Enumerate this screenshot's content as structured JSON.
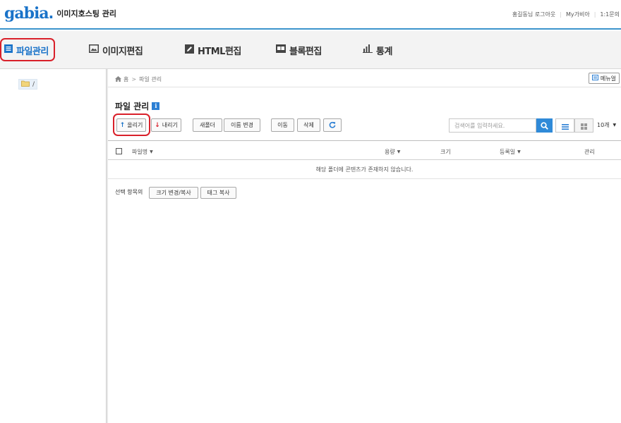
{
  "header": {
    "logo_text": "gabia",
    "service_name": "이미지호스팅 관리",
    "user_greeting": "홍길동님",
    "logout": "로그아웃",
    "my_gabia": "My가비아",
    "inquiry": "1:1문의"
  },
  "nav": {
    "items": [
      {
        "label": "파일관리",
        "icon": "file-list-icon",
        "active": true
      },
      {
        "label": "이미지편집",
        "icon": "image-icon",
        "active": false
      },
      {
        "label": "HTML편집",
        "icon": "pencil-icon",
        "active": false
      },
      {
        "label": "블록편집",
        "icon": "block-icon",
        "active": false
      },
      {
        "label": "통계",
        "icon": "bar-chart-icon",
        "active": false
      }
    ]
  },
  "sidebar": {
    "root_folder": "/"
  },
  "breadcrumb": {
    "home": "홈",
    "current": "파일 관리"
  },
  "menu_button": "메뉴얼",
  "page_title": "파일 관리",
  "toolbar": {
    "upload": "올리기",
    "download": "내리기",
    "new_folder": "새폴더",
    "rename": "이름 변경",
    "move": "이동",
    "delete": "삭제"
  },
  "search": {
    "placeholder": "검색어를 입력하세요."
  },
  "per_page": "10개",
  "table": {
    "columns": [
      "파일명",
      "용량",
      "크기",
      "등록일",
      "관리"
    ],
    "empty_message": "해당 폴더에 콘텐츠가 존재하지 않습니다."
  },
  "selection": {
    "label": "선택 항목의",
    "resize_copy": "크기 변경/복사",
    "tag_copy": "태그 복사"
  },
  "colors": {
    "accent": "#1a73c9",
    "highlight": "#d9202a",
    "search_button": "#2f8ad8"
  }
}
